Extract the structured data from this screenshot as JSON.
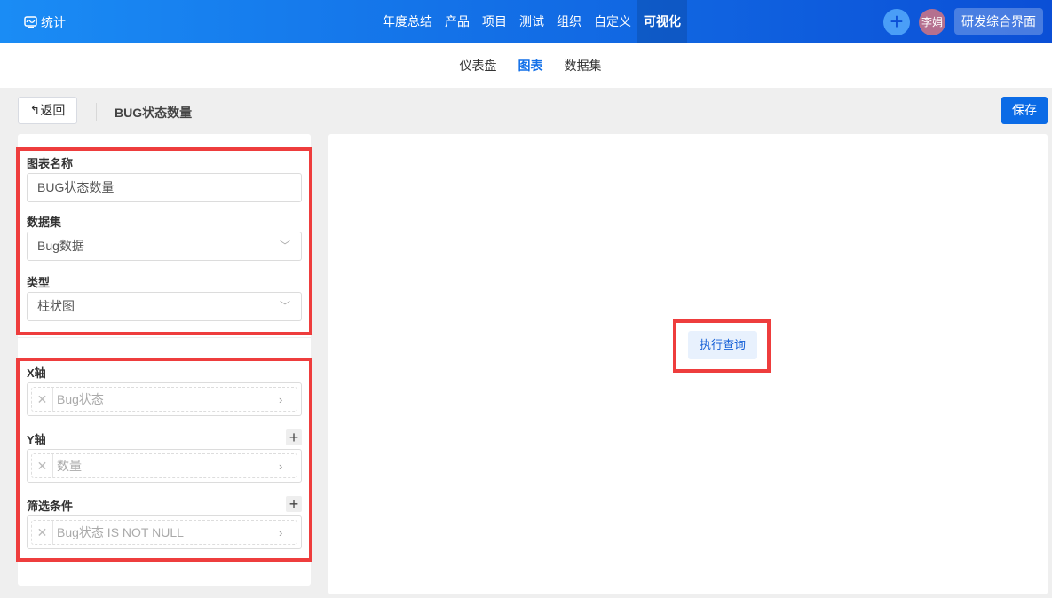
{
  "topbar": {
    "brand": "统计",
    "nav": [
      "年度总结",
      "产品",
      "项目",
      "测试",
      "组织",
      "自定义",
      "可视化"
    ],
    "active_nav": "可视化",
    "avatar": "李娟",
    "workspace": "研发综合界面"
  },
  "subnav": {
    "items": [
      "仪表盘",
      "图表",
      "数据集"
    ],
    "active": "图表"
  },
  "toolbar": {
    "back": "返回",
    "title": "BUG状态数量",
    "save": "保存"
  },
  "form": {
    "name_label": "图表名称",
    "name_value": "BUG状态数量",
    "dataset_label": "数据集",
    "dataset_value": "Bug数据",
    "type_label": "类型",
    "type_value": "柱状图",
    "x_label": "X轴",
    "x_value": "Bug状态",
    "y_label": "Y轴",
    "y_value": "数量",
    "filter_label": "筛选条件",
    "filter_value": "Bug状态 IS NOT NULL"
  },
  "main": {
    "run_query": "执行查询"
  },
  "colors": {
    "accent": "#0b6be6",
    "highlight": "#ee3d3d"
  }
}
